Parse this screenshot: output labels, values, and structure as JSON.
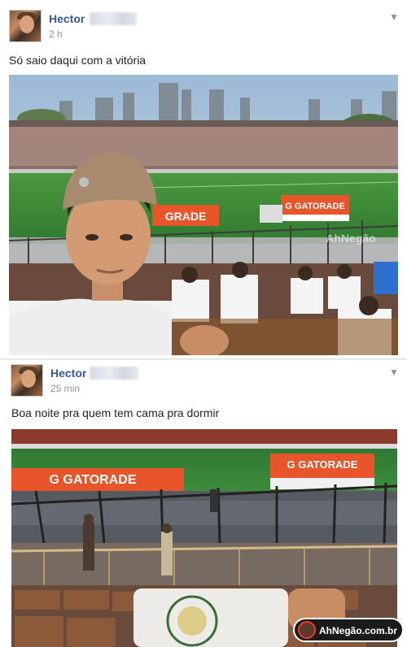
{
  "posts": [
    {
      "author": "Hector",
      "time": "2 h",
      "caption": "Só saio daqui com a vitória",
      "menu_icon": "chevron-down-icon"
    },
    {
      "author": "Hector",
      "time": "25 min",
      "caption": "Boa noite pra quem tem cama pra dormir",
      "menu_icon": "chevron-down-icon"
    }
  ],
  "photo1": {
    "ads": [
      "GRADE",
      "G GATORADE"
    ],
    "watermark": "AhNegão"
  },
  "photo2": {
    "ads": [
      "G GATORADE",
      "G GATORADE"
    ]
  },
  "site_watermark": "AhNegão.com.br",
  "colors": {
    "link": "#365899",
    "meta": "#90949c",
    "pitch": "#3e8f3a",
    "ad_orange": "#e8552a"
  }
}
